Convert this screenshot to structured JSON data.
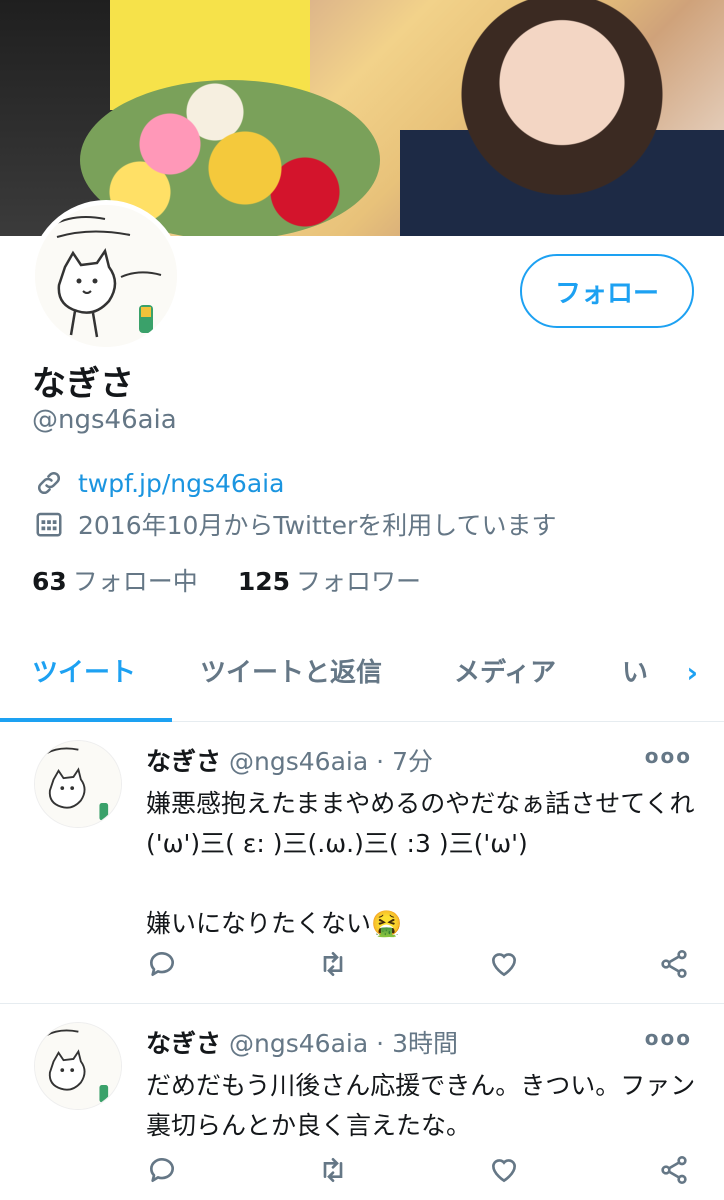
{
  "profile": {
    "follow_label": "フォロー",
    "name": "なぎさ",
    "handle": "@ngs46aia",
    "link": "twpf.jp/ngs46aia",
    "joined": "2016年10月からTwitterを利用しています",
    "following_count": "63",
    "following_label": "フォロー中",
    "followers_count": "125",
    "followers_label": "フォロワー"
  },
  "tabs": [
    {
      "label": "ツイート",
      "active": true
    },
    {
      "label": "ツイートと返信"
    },
    {
      "label": "メディア"
    },
    {
      "label": "い"
    }
  ],
  "tweets": [
    {
      "name": "なぎさ",
      "handle": "@ngs46aia",
      "sep": "·",
      "time": "7分",
      "text": "嫌悪感抱えたままやめるのやだなぁ話させてくれ('ω')三( ε: )三(.ω.)三( :3 )三('ω')\n\n嫌いになりたくない🤮"
    },
    {
      "name": "なぎさ",
      "handle": "@ngs46aia",
      "sep": "·",
      "time": "3時間",
      "text": "だめだもう川後さん応援できん。きつい。ファン裏切らんとか良く言えたな。"
    }
  ],
  "icons": {
    "link": "link-icon",
    "calendar": "calendar-icon",
    "reply": "reply-icon",
    "retweet": "retweet-icon",
    "like": "like-icon",
    "share": "share-icon",
    "more": "more-icon"
  },
  "colors": {
    "accent": "#1da1f2",
    "secondary_text": "#657786"
  }
}
